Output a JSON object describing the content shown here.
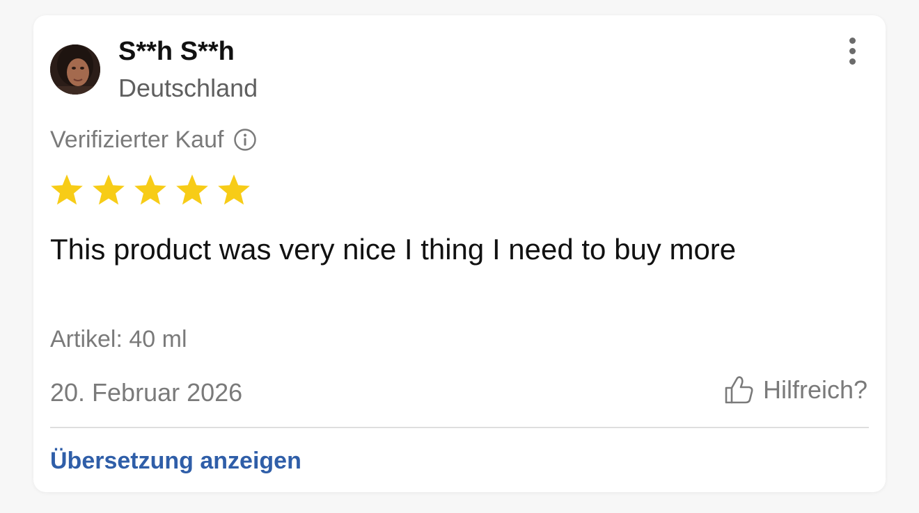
{
  "review": {
    "reviewer_name": "S**h S**h",
    "reviewer_country": "Deutschland",
    "verified_label": "Verifizierter Kauf",
    "rating": 5,
    "rating_max": 5,
    "text": "This product was very nice I thing I need to buy more",
    "variant": "Artikel: 40 ml",
    "date": "20. Februar 2026",
    "helpful_label": "Hilfreich?",
    "translate_label": "Übersetzung anzeigen"
  },
  "icons": {
    "more": "more-vertical-icon",
    "info": "info-icon",
    "star": "star-icon",
    "helpful": "thumbs-up-icon"
  },
  "colors": {
    "star": "#f7cc17",
    "link": "#2f5ea8",
    "secondary_text": "#7a7a7a",
    "primary_text": "#111111"
  }
}
